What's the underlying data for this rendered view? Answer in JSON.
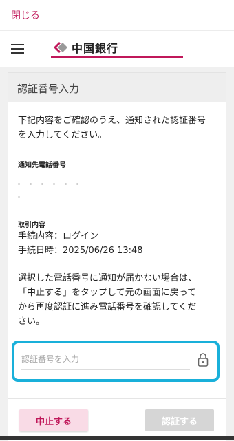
{
  "topbar": {
    "close_label": "閉じる"
  },
  "header": {
    "brand_name": "中国銀行",
    "brand_color": "#c0185a"
  },
  "card": {
    "title": "認証番号入力",
    "intro_line1": "下記内容をご確認のうえ、通知された認証番号",
    "intro_line2": "を入力してください。",
    "phone_heading": "通知先電話番号",
    "transaction_heading": "取引内容",
    "procedure": "手続内容：ログイン",
    "datetime": "手続日時：2025/06/26 13:48",
    "notice_line1": "選択した電話番号に通知が届かない場合は、",
    "notice_line2": "「中止する」をタップして元の画面に戻って",
    "notice_line3": "から再度認証に進み電話番号を確認してくだ",
    "notice_line4": "さい。",
    "input": {
      "placeholder": "認証番号を入力",
      "value": ""
    },
    "lock_icon": "lock-icon",
    "cancel_label": "中止する",
    "confirm_label": "認証する"
  },
  "colors": {
    "accent": "#c0185a",
    "highlight": "#19b0da",
    "disabled": "#d6d6d6"
  }
}
